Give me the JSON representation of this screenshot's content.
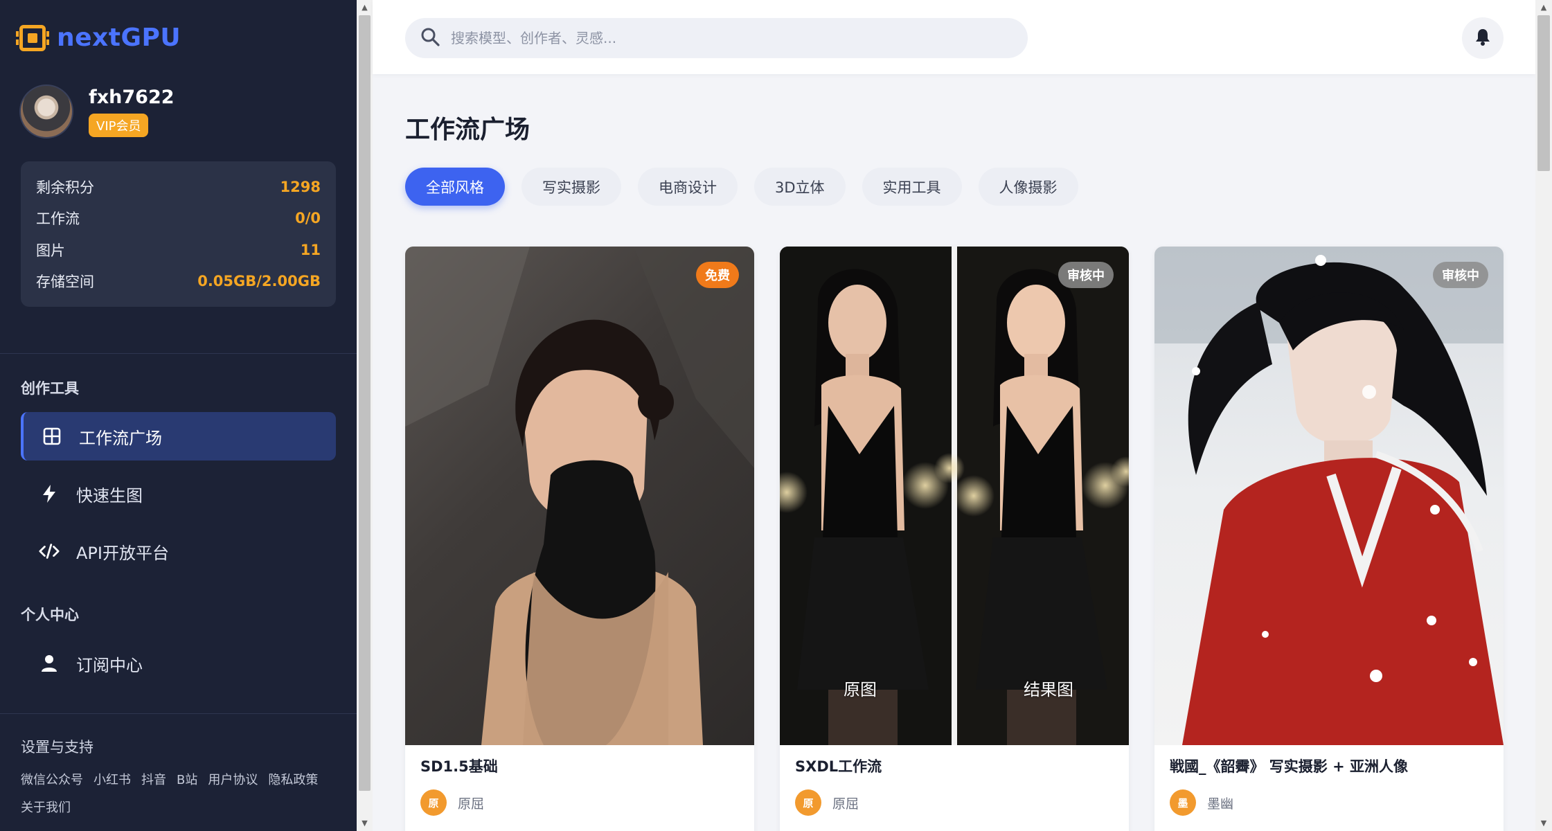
{
  "brand": {
    "name": "nextGPU"
  },
  "user": {
    "name": "fxh7622",
    "badge": "VIP会员"
  },
  "stats": [
    {
      "label": "剩余积分",
      "value": "1298"
    },
    {
      "label": "工作流",
      "value": "0/0"
    },
    {
      "label": "图片",
      "value": "11"
    },
    {
      "label": "存储空间",
      "value": "0.05GB/2.00GB"
    }
  ],
  "sections": {
    "tools": "创作工具",
    "personal": "个人中心",
    "support": "设置与支持"
  },
  "nav": {
    "workflow_plaza": "工作流广场",
    "quick_gen": "快速生图",
    "api": "API开放平台",
    "subscription": "订阅中心"
  },
  "links": [
    "微信公众号",
    "小红书",
    "抖音",
    "B站",
    "用户协议",
    "隐私政策",
    "关于我们"
  ],
  "search": {
    "placeholder": "搜索模型、创作者、灵感..."
  },
  "page": {
    "title": "工作流广场"
  },
  "filters": [
    "全部风格",
    "写实摄影",
    "电商设计",
    "3D立体",
    "实用工具",
    "人像摄影"
  ],
  "cards": [
    {
      "title": "SD1.5基础",
      "badge": "免费",
      "author": "原屈",
      "author_initial": "原"
    },
    {
      "title": "SXDL工作流",
      "badge": "审核中",
      "author": "原屈",
      "author_initial": "原",
      "left_label": "原图",
      "right_label": "结果图"
    },
    {
      "title": "戦國_《韶霽》 写实摄影 + 亚洲人像",
      "badge": "审核中",
      "author": "墨幽",
      "author_initial": "墨"
    }
  ],
  "colors": {
    "accent": "#3d63f0",
    "brand": "#4b74ff",
    "highlight": "#f5a623",
    "sidebar": "#1c2236"
  }
}
